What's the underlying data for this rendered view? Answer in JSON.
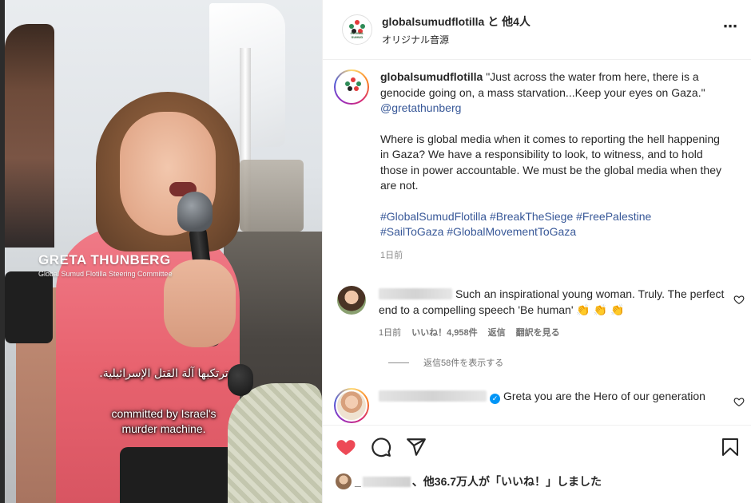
{
  "media": {
    "overlay_name": "GRETA THUNBERG",
    "overlay_role": "Global Sumud Flotilla Steering Committee",
    "subtitle_ar": "ترتكبها آلة القتل الإسرائيلية.",
    "subtitle_en_line1": "committed by Israel's",
    "subtitle_en_line2": "murder machine."
  },
  "header": {
    "username": "globalsumudflotilla と 他4人",
    "audio": "オリジナル音源",
    "more_icon": "⋯",
    "logo_text": "GLOBAL SUMUD"
  },
  "caption": {
    "username": "globalsumudflotilla",
    "text1": " \"Just across the water from here, there is a genocide going on, a mass starvation...Keep your eyes on Gaza.\" ",
    "mention": "@gretathunberg",
    "text2": "Where is global media when it comes to reporting the hell happening in Gaza? We have a responsibility to look, to witness, and to hold those in power accountable. We must be the global media when they are not.",
    "hashtags_line1": "#GlobalSumudFlotilla #BreakTheSiege #FreePalestine",
    "hashtags_line2": "#SailToGaza #GlobalMovementToGaza",
    "time": "1日前"
  },
  "comments": [
    {
      "text": "Such an inspirational young woman. Truly. The perfect end to a compelling speech 'Be human' 👏 👏 👏",
      "time": "1日前",
      "likes": "いいね！4,958件",
      "reply": "返信",
      "translate": "翻訳を見る"
    },
    {
      "text": "Greta you are the Hero of our generation",
      "verified": "✓"
    }
  ],
  "view_replies": "返信58件を表示する",
  "likes_summary": {
    "prefix": "_",
    "suffix": "、他36.7万人が「いいね！」しました"
  },
  "colors": {
    "like_red": "#ed4956",
    "link_blue": "#385898",
    "verified_blue": "#0095f6"
  }
}
